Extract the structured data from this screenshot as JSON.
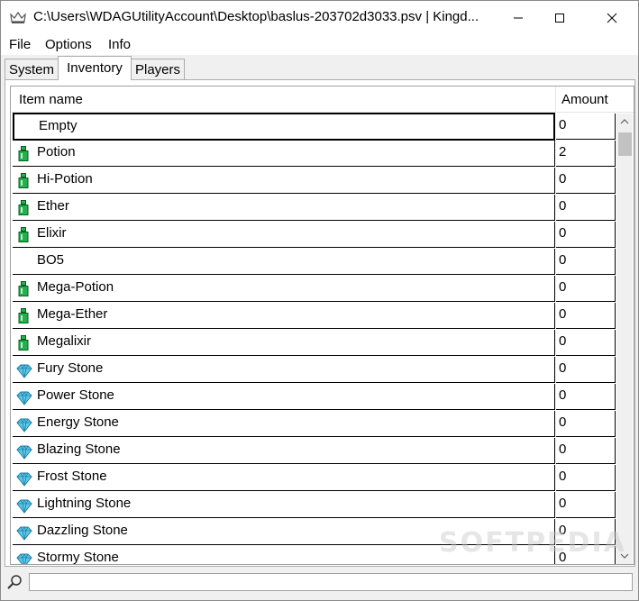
{
  "window": {
    "title": "C:\\Users\\WDAGUtilityAccount\\Desktop\\baslus-203702d3033.psv | Kingd..."
  },
  "menu": [
    {
      "label": "File"
    },
    {
      "label": "Options"
    },
    {
      "label": "Info"
    }
  ],
  "tabs": [
    {
      "label": "System"
    },
    {
      "label": "Inventory"
    },
    {
      "label": "Players"
    }
  ],
  "grid": {
    "columns": {
      "name": "Item name",
      "amount": "Amount"
    },
    "rows": [
      {
        "name": "Empty",
        "amount": "0",
        "icon": "none"
      },
      {
        "name": "Potion",
        "amount": "2",
        "icon": "bottle-icon"
      },
      {
        "name": "Hi-Potion",
        "amount": "0",
        "icon": "bottle-icon"
      },
      {
        "name": "Ether",
        "amount": "0",
        "icon": "bottle-icon"
      },
      {
        "name": "Elixir",
        "amount": "0",
        "icon": "bottle-icon"
      },
      {
        "name": "BO5",
        "amount": "0",
        "icon": "none"
      },
      {
        "name": "Mega-Potion",
        "amount": "0",
        "icon": "bottle-icon"
      },
      {
        "name": "Mega-Ether",
        "amount": "0",
        "icon": "bottle-icon"
      },
      {
        "name": "Megalixir",
        "amount": "0",
        "icon": "bottle-icon"
      },
      {
        "name": "Fury Stone",
        "amount": "0",
        "icon": "gem-icon"
      },
      {
        "name": "Power Stone",
        "amount": "0",
        "icon": "gem-icon"
      },
      {
        "name": "Energy Stone",
        "amount": "0",
        "icon": "gem-icon"
      },
      {
        "name": "Blazing Stone",
        "amount": "0",
        "icon": "gem-icon"
      },
      {
        "name": "Frost Stone",
        "amount": "0",
        "icon": "gem-icon"
      },
      {
        "name": "Lightning Stone",
        "amount": "0",
        "icon": "gem-icon"
      },
      {
        "name": "Dazzling Stone",
        "amount": "0",
        "icon": "gem-icon"
      },
      {
        "name": "Stormy Stone",
        "amount": "0",
        "icon": "gem-icon"
      }
    ]
  },
  "search": {
    "value": "",
    "placeholder": ""
  },
  "watermark": "SOFTPEDIA",
  "colors": {
    "bottle": "#22b14c",
    "gem": "#5fc8e8"
  }
}
